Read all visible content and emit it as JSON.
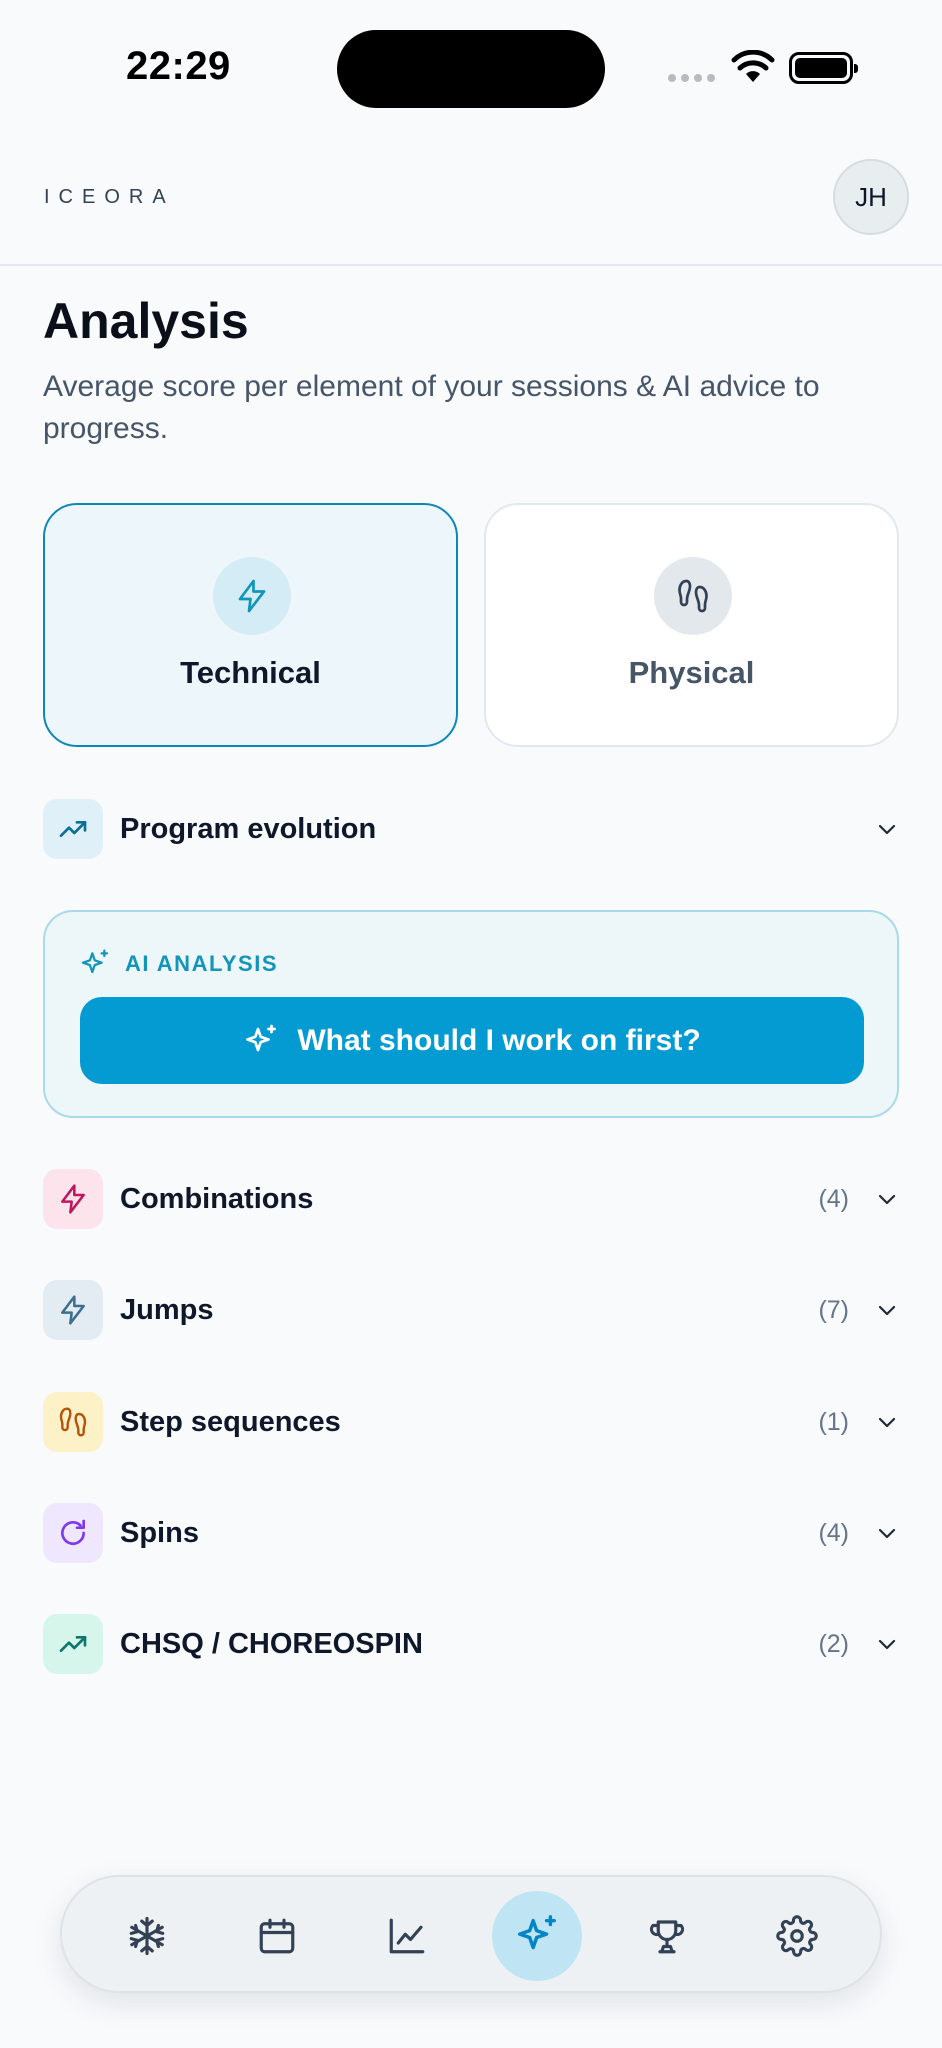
{
  "status_bar": {
    "time": "22:29"
  },
  "header": {
    "logo": "ICEORA",
    "avatar_initials": "JH"
  },
  "page": {
    "title": "Analysis",
    "subtitle": "Average score per element of your sessions & AI advice to progress."
  },
  "modes": [
    {
      "label": "Technical",
      "icon": "bolt-icon",
      "active": true
    },
    {
      "label": "Physical",
      "icon": "footprints-icon",
      "active": false
    }
  ],
  "program_evolution": {
    "label": "Program evolution",
    "icon": "trend-up-icon"
  },
  "ai_analysis": {
    "label": "AI ANALYSIS",
    "button_label": "What should I work on first?",
    "icon": "sparkles-icon"
  },
  "sections": [
    {
      "label": "Combinations",
      "count": "(4)",
      "icon": "bolt-icon",
      "color": "#be185d"
    },
    {
      "label": "Jumps",
      "count": "(7)",
      "icon": "bolt-icon",
      "color": "#3b6e8f"
    },
    {
      "label": "Step sequences",
      "count": "(1)",
      "icon": "footprints-icon",
      "color": "#b45309"
    },
    {
      "label": "Spins",
      "count": "(4)",
      "icon": "rotate-icon",
      "color": "#7c3aed"
    },
    {
      "label": "CHSQ / CHOREOSPIN",
      "count": "(2)",
      "icon": "trend-up-icon",
      "color": "#0f766e"
    }
  ],
  "bottom_nav": [
    {
      "name": "snowflake-icon",
      "active": false
    },
    {
      "name": "calendar-icon",
      "active": false
    },
    {
      "name": "chart-icon",
      "active": false
    },
    {
      "name": "sparkles-icon",
      "active": true
    },
    {
      "name": "trophy-icon",
      "active": false
    },
    {
      "name": "gear-icon",
      "active": false
    }
  ],
  "colors": {
    "accent": "#039bd1",
    "accent_dark": "#0e87b8",
    "background": "#f8fafc"
  }
}
